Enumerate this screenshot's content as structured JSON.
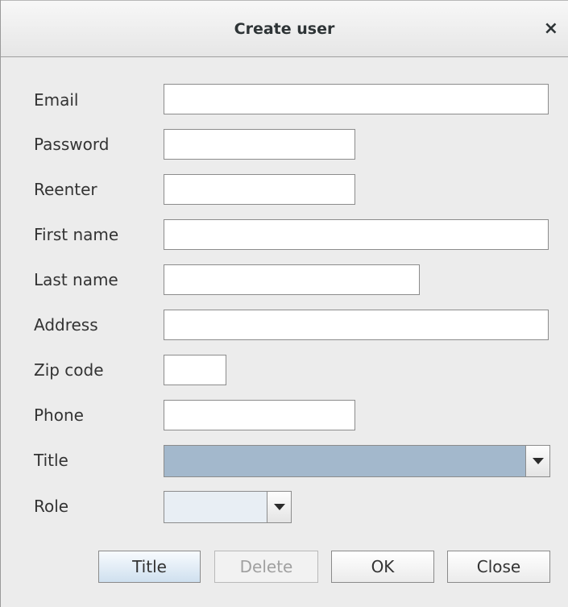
{
  "window": {
    "title": "Create user",
    "close_glyph": "×"
  },
  "form": {
    "email": {
      "label": "Email",
      "value": ""
    },
    "password": {
      "label": "Password",
      "value": ""
    },
    "reenter": {
      "label": "Reenter",
      "value": ""
    },
    "first_name": {
      "label": "First name",
      "value": ""
    },
    "last_name": {
      "label": "Last name",
      "value": ""
    },
    "address": {
      "label": "Address",
      "value": ""
    },
    "zip_code": {
      "label": "Zip code",
      "value": ""
    },
    "phone": {
      "label": "Phone",
      "value": ""
    },
    "title": {
      "label": "Title",
      "selected": ""
    },
    "role": {
      "label": "Role",
      "selected": ""
    }
  },
  "buttons": {
    "title": "Title",
    "delete": "Delete",
    "ok": "OK",
    "close": "Close"
  },
  "colors": {
    "title_combo_selected_bg": "#a3b8cc",
    "role_combo_bg": "#e8eef4",
    "primary_button_gradient_end": "#cfe0ef"
  }
}
